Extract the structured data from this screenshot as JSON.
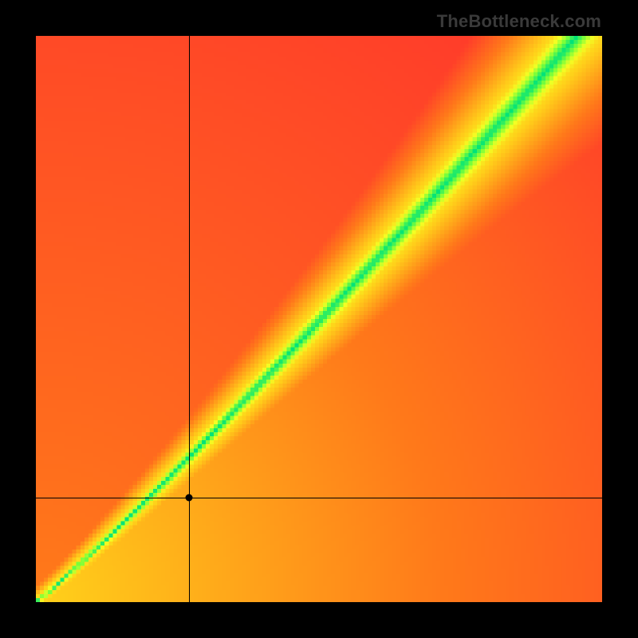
{
  "watermark": "TheBottleneck.com",
  "chart_data": {
    "type": "heatmap",
    "title": "",
    "xlabel": "",
    "ylabel": "",
    "xlim": [
      0,
      1
    ],
    "ylim": [
      0,
      1
    ],
    "grid": false,
    "legend": false,
    "color_scale": [
      "#ff2e2e",
      "#ff7a1a",
      "#ffd21a",
      "#f4ff24",
      "#7cff3a",
      "#00e37a"
    ],
    "field": "bottleneck_match",
    "description": "Value is closeness of (x,y) to the optimal diagonal band; green = best match, red = worst. An additional warm radial gradient emanates from the origin.",
    "optimal_band": {
      "curve": "y ≈ x^1.25 with slight upward curvature near origin",
      "width_at_origin": 0.01,
      "width_at_max": 0.1
    },
    "crosshair": {
      "x": 0.27,
      "y": 0.185
    },
    "marker": {
      "x": 0.27,
      "y": 0.185
    },
    "resolution": 140
  }
}
